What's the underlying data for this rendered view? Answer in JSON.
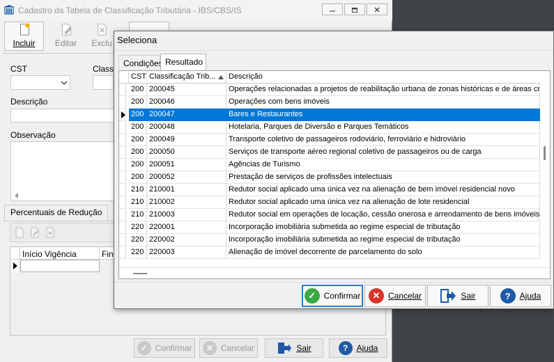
{
  "main_window": {
    "title": "Cadastro da Tabela de Classificação Tributária - IBS/CBS/IS",
    "toolbar": {
      "incluir": "Incluir",
      "editar": "Editar",
      "excluir": "Exclu"
    },
    "fields": {
      "cst_label": "CST",
      "classif_label": "Classi",
      "descricao_label": "Descrição",
      "observacao_label": "Observação"
    },
    "percentuais_tab": "Percentuais de Redução",
    "sub_table": {
      "col1": "Início Vigência",
      "col2": "Fina"
    },
    "buttons": {
      "confirmar": "Confirmar",
      "cancelar": "Cancelar",
      "sair": "Sair",
      "ajuda": "Ajuda"
    }
  },
  "dialog": {
    "title": "Seleciona",
    "tabs": [
      "Condições",
      "Resultado"
    ],
    "active_tab": "Resultado",
    "grid": {
      "columns": [
        "CST",
        "Classificação Trib...",
        "Descrição"
      ],
      "sorted_column": "Classificação Trib...",
      "rows": [
        {
          "cst": "200",
          "classif": "200045",
          "descricao": "Operações relacionadas a projetos de reabilitação urbana de zonas históricas e de áreas cr"
        },
        {
          "cst": "200",
          "classif": "200046",
          "descricao": "Operações com bens imóveis"
        },
        {
          "cst": "200",
          "classif": "200047",
          "descricao": "Bares e Restaurantes"
        },
        {
          "cst": "200",
          "classif": "200048",
          "descricao": "Hotelaria, Parques de Diversão e Parques Temáticos"
        },
        {
          "cst": "200",
          "classif": "200049",
          "descricao": "Transporte coletivo de passageiros rodoviário, ferroviário e hidroviário"
        },
        {
          "cst": "200",
          "classif": "200050",
          "descricao": "Serviços de transporte aéreo regional coletivo de passageiros ou de carga"
        },
        {
          "cst": "200",
          "classif": "200051",
          "descricao": "Agências de Turismo"
        },
        {
          "cst": "200",
          "classif": "200052",
          "descricao": "Prestação de serviços de profissões intelectuais"
        },
        {
          "cst": "210",
          "classif": "210001",
          "descricao": "Redutor social aplicado uma única vez na alienação de bem imóvel residencial novo"
        },
        {
          "cst": "210",
          "classif": "210002",
          "descricao": "Redutor social aplicado uma única vez na alienação de lote residencial"
        },
        {
          "cst": "210",
          "classif": "210003",
          "descricao": "Redutor social em operações de locação, cessão onerosa e arrendamento de bens imóveis c"
        },
        {
          "cst": "220",
          "classif": "220001",
          "descricao": "Incorporação imobiliária submetida ao regime especial de tributação"
        },
        {
          "cst": "220",
          "classif": "220002",
          "descricao": "Incorporação imobiliária submetida ao regime especial de tributação"
        },
        {
          "cst": "220",
          "classif": "220003",
          "descricao": "Alienação de imóvel decorrente de parcelamento do solo"
        }
      ],
      "selected_classif": "200047"
    },
    "buttons": {
      "confirmar": "Confirmar",
      "cancelar": "Cancelar",
      "sair": "Sair",
      "ajuda": "Ajuda"
    }
  },
  "colors": {
    "selection": "#0078d7",
    "confirm_green": "#3aa845",
    "cancel_red": "#d9342b",
    "help_blue": "#1f5aa6"
  }
}
